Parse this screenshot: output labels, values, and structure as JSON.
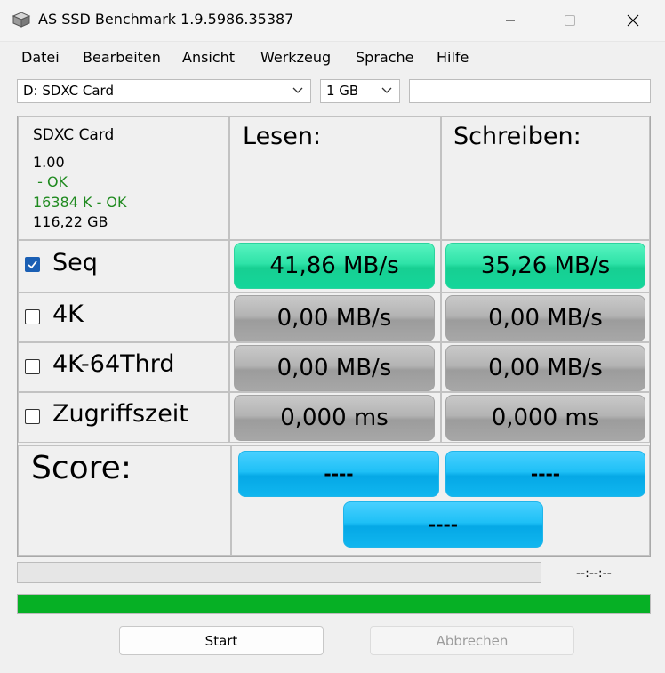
{
  "window": {
    "title": "AS SSD Benchmark 1.9.5986.35387"
  },
  "menu": [
    "Datei",
    "Bearbeiten",
    "Ansicht",
    "Werkzeug",
    "Sprache",
    "Hilfe"
  ],
  "toolbar": {
    "drive": "D: SDXC Card",
    "size": "1 GB",
    "extra": ""
  },
  "drive_info": {
    "name": "SDXC Card",
    "version": "1.00",
    "status1": " - OK",
    "status2": "16384 K - OK",
    "capacity": "116,22 GB"
  },
  "columns": {
    "read": "Lesen:",
    "write": "Schreiben:"
  },
  "tests": [
    {
      "label": "Seq",
      "checked": true,
      "read": "41,86 MB/s",
      "write": "35,26 MB/s",
      "style": "green"
    },
    {
      "label": "4K",
      "checked": false,
      "read": "0,00 MB/s",
      "write": "0,00 MB/s",
      "style": "gray"
    },
    {
      "label": "4K-64Thrd",
      "checked": false,
      "read": "0,00 MB/s",
      "write": "0,00 MB/s",
      "style": "gray"
    },
    {
      "label": "Zugriffszeit",
      "checked": false,
      "read": "0,000 ms",
      "write": "0,000 ms",
      "style": "gray"
    }
  ],
  "score": {
    "label": "Score:",
    "read": "----",
    "write": "----",
    "total": "----"
  },
  "progress": {
    "elapsed": "--:--:--",
    "fraction": 0
  },
  "overall": {
    "fraction": 1.0
  },
  "buttons": {
    "start": "Start",
    "cancel": "Abbrechen"
  },
  "colors": {
    "green_result": "#2ee3a8",
    "gray_result": "#b3b3b3",
    "blue_score": "#1ec0f6",
    "progress_green": "#06b025",
    "status_ok": "#1f8a1f"
  }
}
